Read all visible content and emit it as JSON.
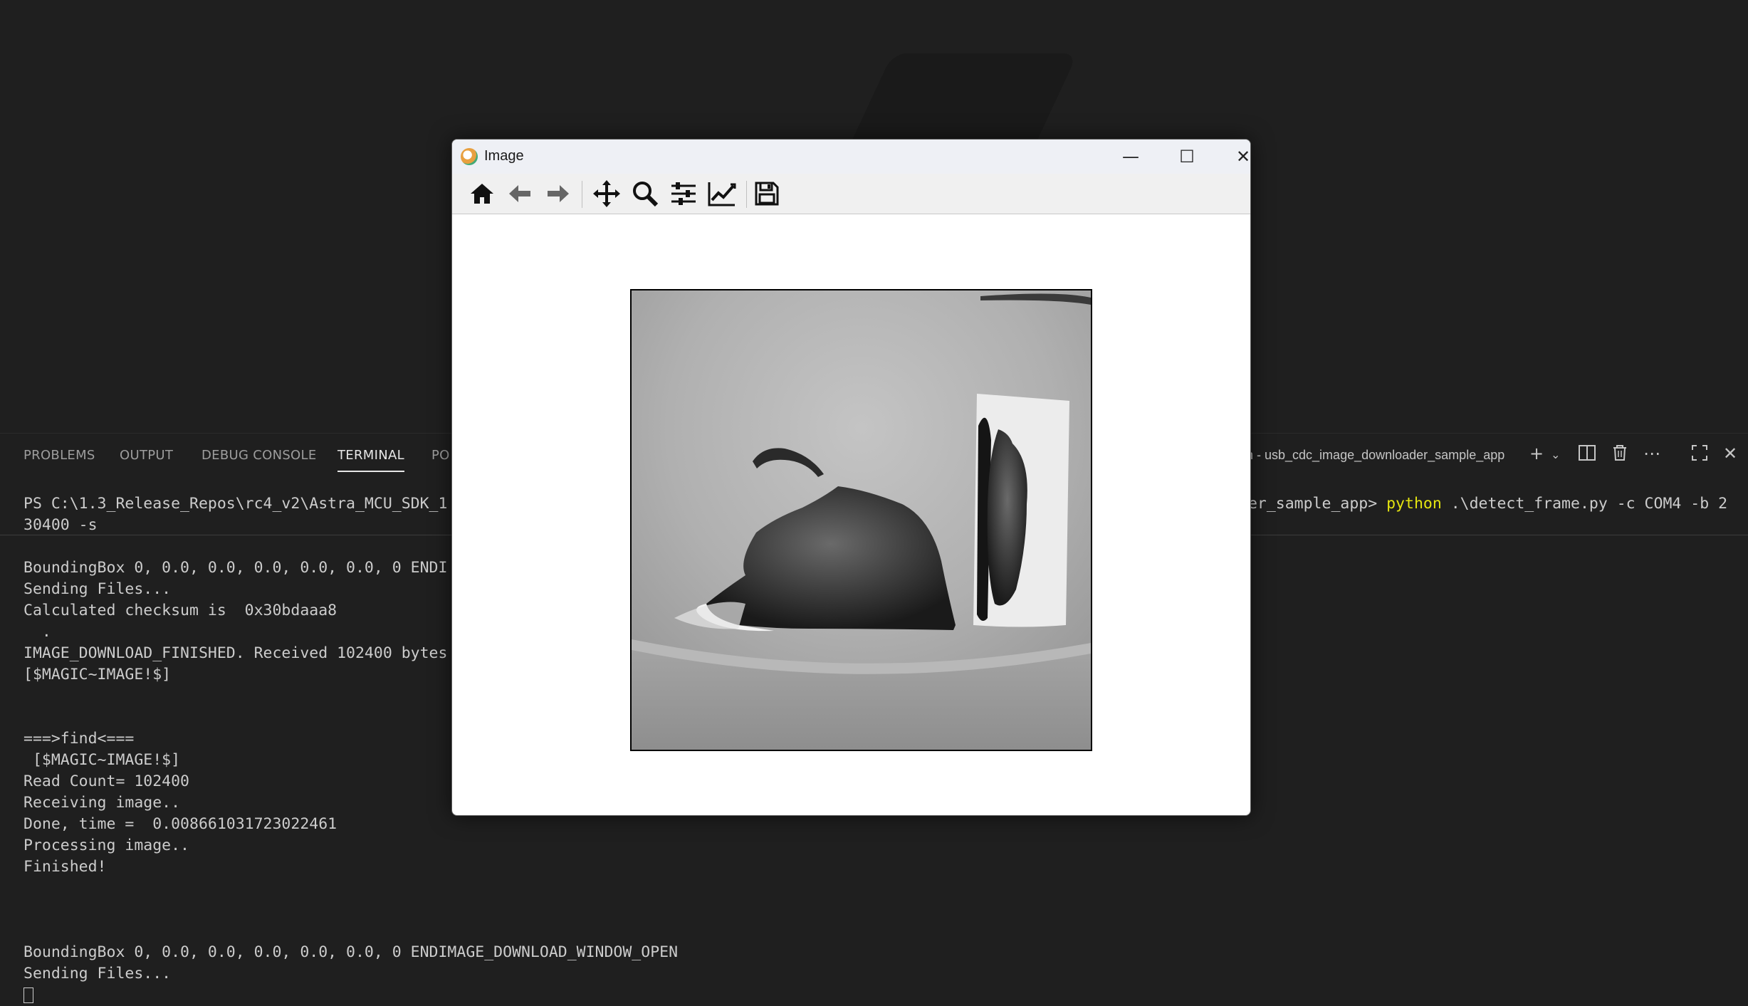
{
  "panel": {
    "tabs": [
      "PROBLEMS",
      "OUTPUT",
      "DEBUG CONSOLE",
      "TERMINAL",
      "PO"
    ],
    "active_tab": "TERMINAL",
    "terminal_name": "n - usb_cdc_image_downloader_sample_app"
  },
  "terminal": {
    "prompt_left": "PS C:\\1.3_Release_Repos\\rc4_v2\\Astra_MCU_SDK_1",
    "prompt_right": "der_sample_app> ",
    "command_word": "python",
    "command_args": " .\\detect_frame.py -c COM4 -b 2",
    "wrap_line": "30400 -s",
    "lines": [
      "",
      "BoundingBox 0, 0.0, 0.0, 0.0, 0.0, 0.0, 0 ENDI",
      "Sending Files...",
      "Calculated checksum is  0x30bdaaa8",
      "  .",
      "IMAGE_DOWNLOAD_FINISHED. Received 102400 bytes",
      "[$MAGIC~IMAGE!$]",
      "",
      "",
      "===>find<===",
      " [$MAGIC~IMAGE!$]",
      "Read Count= 102400",
      "Receiving image..",
      "Done, time =  0.008661031723022461",
      "Processing image..",
      "Finished!",
      "",
      "",
      "",
      "BoundingBox 0, 0.0, 0.0, 0.0, 0.0, 0.0, 0 ENDIMAGE_DOWNLOAD_WINDOW_OPEN",
      "Sending Files..."
    ]
  },
  "window": {
    "title": "Image",
    "toolbar": [
      "home-icon",
      "back-icon",
      "forward-icon",
      "pan-icon",
      "zoom-icon",
      "configure-subplots-icon",
      "edit-axis-icon",
      "save-icon"
    ]
  }
}
